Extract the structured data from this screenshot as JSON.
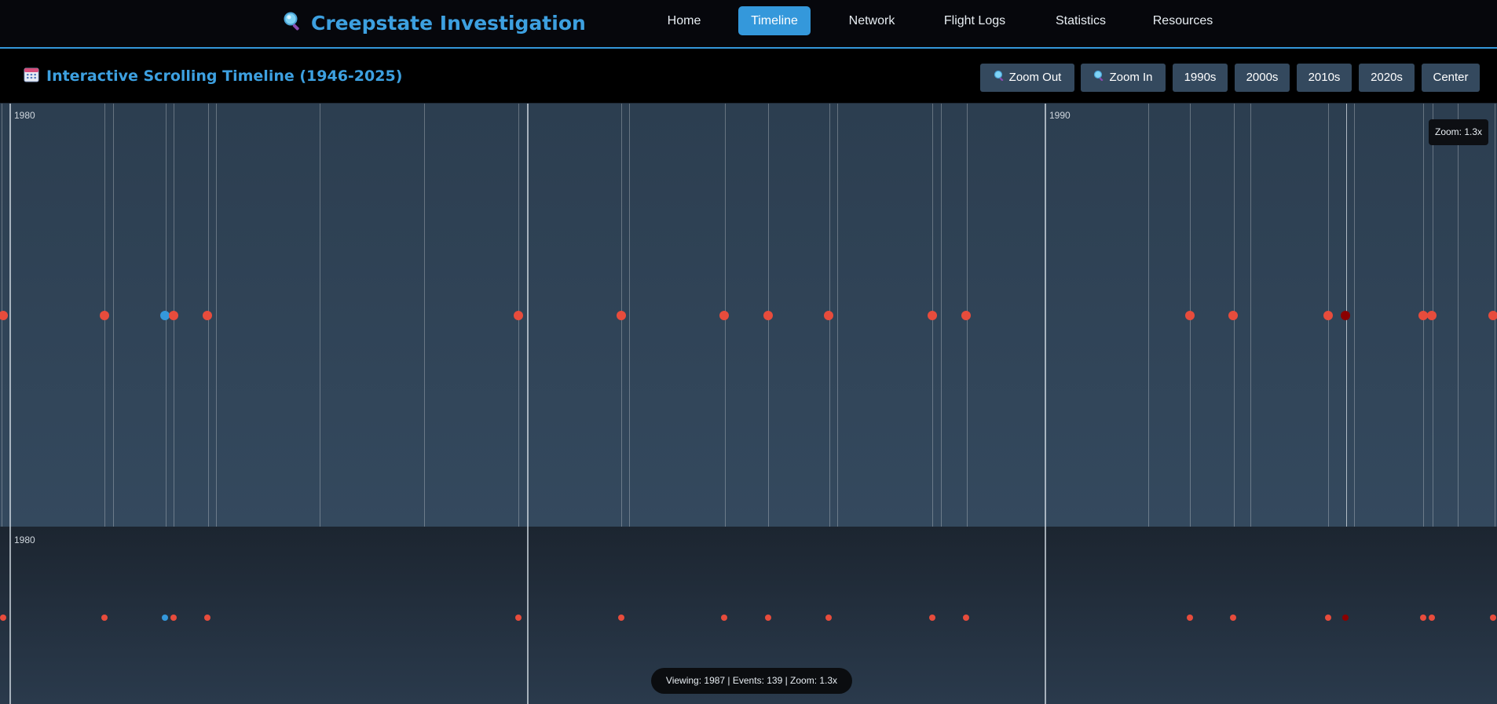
{
  "brand": {
    "title": "Creepstate Investigation",
    "icon": "magnifier-icon"
  },
  "nav": [
    {
      "label": "Home",
      "active": false
    },
    {
      "label": "Timeline",
      "active": true
    },
    {
      "label": "Network",
      "active": false
    },
    {
      "label": "Flight Logs",
      "active": false
    },
    {
      "label": "Statistics",
      "active": false
    },
    {
      "label": "Resources",
      "active": false
    }
  ],
  "timeline": {
    "title": "Interactive Scrolling Timeline (1946-2025)",
    "icon": "calendar-icon",
    "controls": {
      "zoom_out": "Zoom Out",
      "zoom_in": "Zoom In",
      "decade_1990s": "1990s",
      "decade_2000s": "2000s",
      "decade_2010s": "2010s",
      "decade_2020s": "2020s",
      "center": "Center"
    },
    "zoom_badge": "Zoom: 1.3x",
    "status": "Viewing: 1987 | Events: 139 | Zoom: 1.3x",
    "year_labels": {
      "main_1980": "1980",
      "main_1990": "1990",
      "mini_1980": "1980"
    }
  },
  "colors": {
    "accent": "#3498db",
    "event_default": "#e74c3c",
    "event_highlight": "#3498db",
    "event_dark": "#8b0000"
  }
}
